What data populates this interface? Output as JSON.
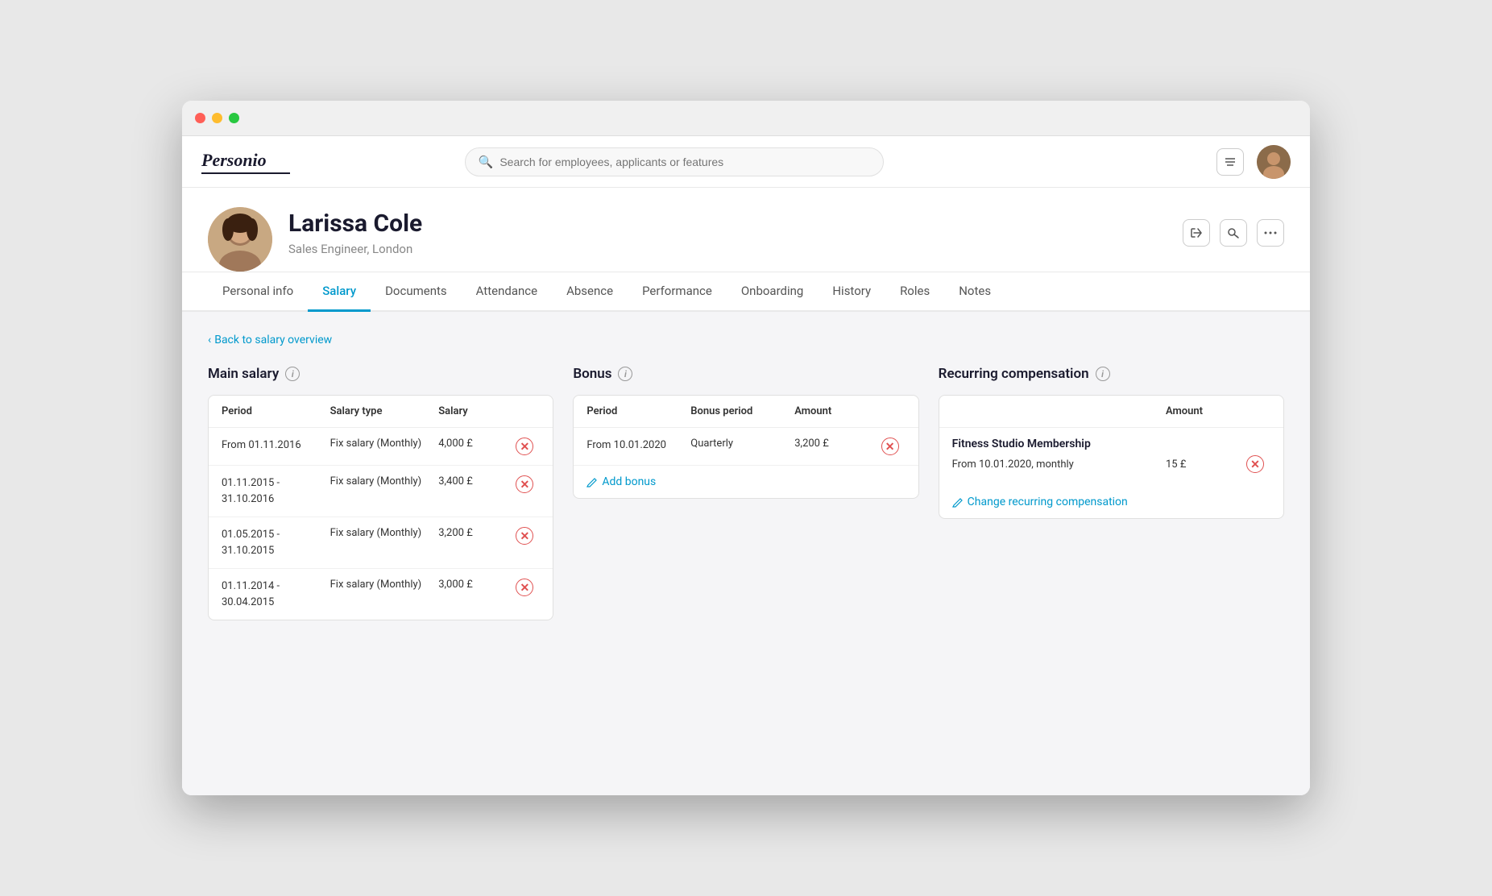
{
  "window": {
    "title": "Personio"
  },
  "logo": "Personio",
  "search": {
    "placeholder": "Search for employees, applicants or features"
  },
  "employee": {
    "name": "Larissa Cole",
    "title": "Sales Engineer, London"
  },
  "tabs": {
    "items": [
      {
        "label": "Personal info",
        "active": false
      },
      {
        "label": "Salary",
        "active": true
      },
      {
        "label": "Documents",
        "active": false
      },
      {
        "label": "Attendance",
        "active": false
      },
      {
        "label": "Absence",
        "active": false
      },
      {
        "label": "Performance",
        "active": false
      },
      {
        "label": "Onboarding",
        "active": false
      },
      {
        "label": "History",
        "active": false
      },
      {
        "label": "Roles",
        "active": false
      },
      {
        "label": "Notes",
        "active": false
      }
    ]
  },
  "back_link": "Back to salary overview",
  "main_salary": {
    "title": "Main salary",
    "headers": [
      "Period",
      "Salary type",
      "Salary"
    ],
    "rows": [
      {
        "period": "From 01.11.2016",
        "type": "Fix salary (Monthly)",
        "salary": "4,000 £"
      },
      {
        "period": "01.11.2015 - 31.10.2016",
        "type": "Fix salary (Monthly)",
        "salary": "3,400 £"
      },
      {
        "period": "01.05.2015 - 31.10.2015",
        "type": "Fix salary (Monthly)",
        "salary": "3,200 £"
      },
      {
        "period": "01.11.2014 - 30.04.2015",
        "type": "Fix salary (Monthly)",
        "salary": "3,000 £"
      }
    ]
  },
  "bonus": {
    "title": "Bonus",
    "headers": [
      "Period",
      "Bonus period",
      "Amount"
    ],
    "rows": [
      {
        "period": "From 10.01.2020",
        "bonus_period": "Quarterly",
        "amount": "3,200 £"
      }
    ],
    "add_label": "Add bonus"
  },
  "recurring_compensation": {
    "title": "Recurring compensation",
    "headers": [
      "",
      "Amount"
    ],
    "items": [
      {
        "name": "Fitness Studio Membership",
        "rows": [
          {
            "period": "From 10.01.2020, monthly",
            "amount": "15 £"
          }
        ]
      }
    ],
    "change_label": "Change recurring compensation"
  }
}
